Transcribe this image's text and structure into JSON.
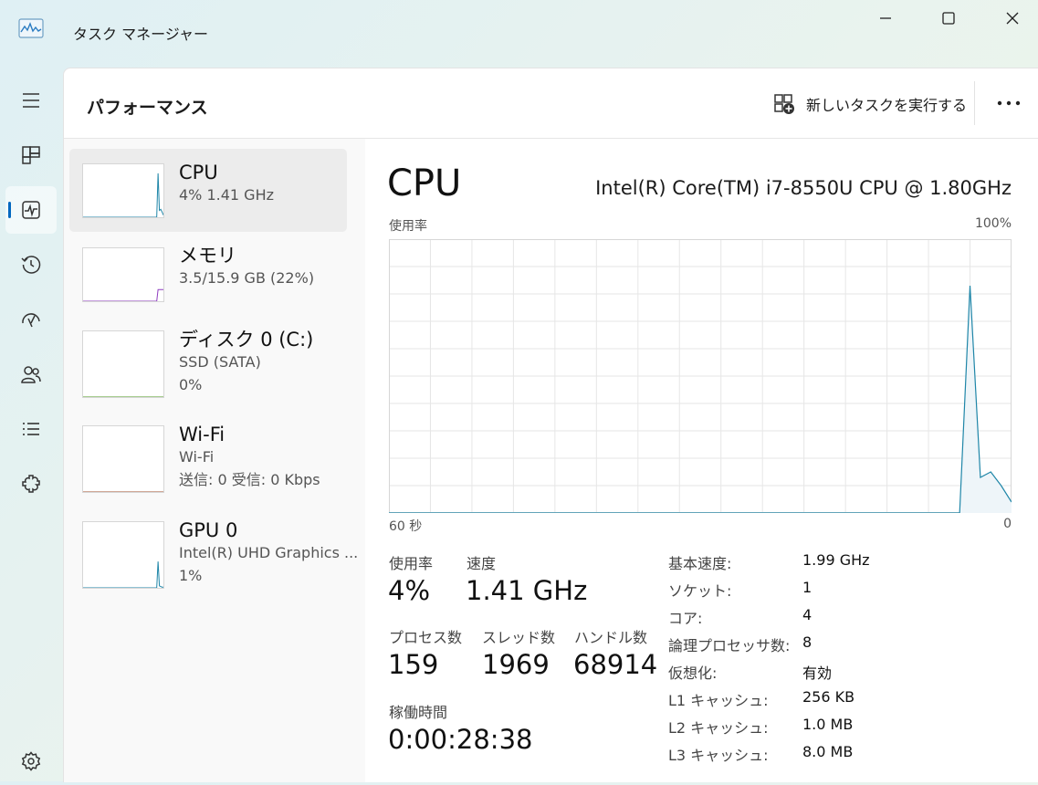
{
  "window": {
    "title": "タスク マネージャー",
    "controls": [
      "minimize-icon",
      "maximize-icon",
      "close-icon"
    ]
  },
  "nav": {
    "items": [
      {
        "name": "hamburger-icon",
        "active": false
      },
      {
        "name": "processes-icon",
        "active": false
      },
      {
        "name": "performance-icon",
        "active": true
      },
      {
        "name": "app-history-icon",
        "active": false
      },
      {
        "name": "startup-apps-icon",
        "active": false
      },
      {
        "name": "users-icon",
        "active": false
      },
      {
        "name": "details-icon",
        "active": false
      },
      {
        "name": "services-icon",
        "active": false
      },
      {
        "name": "settings-icon",
        "active": false
      }
    ]
  },
  "header": {
    "title": "パフォーマンス",
    "new_task_label": "新しいタスクを実行する",
    "new_task_icon": "new-task-icon",
    "more_icon": "more-options-icon"
  },
  "resources": [
    {
      "name": "CPU",
      "lines": [
        "4%  1.41 GHz"
      ],
      "active": true,
      "color": "#1f86a8",
      "thumb_series": [
        0,
        0,
        0,
        0,
        0,
        0,
        0,
        0,
        0,
        0,
        0,
        0,
        0,
        0,
        0,
        0,
        0,
        0,
        0,
        0,
        0,
        0,
        0,
        0,
        0,
        0,
        0,
        0,
        0,
        0,
        0,
        0,
        0,
        0,
        0,
        0,
        0,
        0,
        0,
        0,
        0,
        0,
        0,
        0,
        0,
        0,
        0,
        0,
        0,
        0,
        0,
        0,
        0,
        0,
        0,
        0,
        83,
        13,
        15,
        10,
        4
      ]
    },
    {
      "name": "メモリ",
      "lines": [
        "3.5/15.9 GB (22%)"
      ],
      "active": false,
      "color": "#8e3bbf",
      "thumb_series": [
        0,
        0,
        0,
        0,
        0,
        0,
        0,
        0,
        0,
        0,
        0,
        0,
        0,
        0,
        0,
        0,
        0,
        0,
        0,
        0,
        0,
        0,
        0,
        0,
        0,
        0,
        0,
        0,
        0,
        0,
        0,
        0,
        0,
        0,
        0,
        0,
        0,
        0,
        0,
        0,
        0,
        0,
        0,
        0,
        0,
        0,
        0,
        0,
        0,
        0,
        0,
        0,
        0,
        0,
        0,
        0,
        22,
        22,
        22,
        22,
        22
      ]
    },
    {
      "name": "ディスク 0 (C:)",
      "lines": [
        "SSD (SATA)",
        "0%"
      ],
      "active": false,
      "color": "#4d9a1c",
      "thumb_series": [
        0,
        0,
        0,
        0,
        0,
        0,
        0,
        0,
        0,
        0,
        0,
        0,
        0,
        0,
        0,
        0,
        0,
        0,
        0,
        0,
        0,
        0,
        0,
        0,
        0,
        0,
        0,
        0,
        0,
        0,
        0,
        0,
        0,
        0,
        0,
        0,
        0,
        0,
        0,
        0,
        0,
        0,
        0,
        0,
        0,
        0,
        0,
        0,
        0,
        0,
        0,
        0,
        0,
        0,
        0,
        0,
        0,
        0,
        0,
        0,
        0
      ]
    },
    {
      "name": "Wi-Fi",
      "lines": [
        "Wi-Fi",
        "送信: 0  受信: 0 Kbps"
      ],
      "active": false,
      "color": "#a0522d",
      "thumb_series": [
        0,
        0,
        0,
        0,
        0,
        0,
        0,
        0,
        0,
        0,
        0,
        0,
        0,
        0,
        0,
        0,
        0,
        0,
        0,
        0,
        0,
        0,
        0,
        0,
        0,
        0,
        0,
        0,
        0,
        0,
        0,
        0,
        0,
        0,
        0,
        0,
        0,
        0,
        0,
        0,
        0,
        0,
        0,
        0,
        0,
        0,
        0,
        0,
        0,
        0,
        0,
        0,
        0,
        0,
        0,
        0,
        0,
        0,
        0,
        0,
        0
      ]
    },
    {
      "name": "GPU 0",
      "lines": [
        "Intel(R) UHD Graphics ...",
        "1%"
      ],
      "active": false,
      "color": "#1f86a8",
      "thumb_series": [
        0,
        0,
        0,
        0,
        0,
        0,
        0,
        0,
        0,
        0,
        0,
        0,
        0,
        0,
        0,
        0,
        0,
        0,
        0,
        0,
        0,
        0,
        0,
        0,
        0,
        0,
        0,
        0,
        0,
        0,
        0,
        0,
        0,
        0,
        0,
        0,
        0,
        0,
        0,
        0,
        0,
        0,
        0,
        0,
        0,
        0,
        0,
        0,
        0,
        0,
        0,
        0,
        0,
        0,
        0,
        0,
        40,
        3,
        2,
        1,
        1
      ]
    }
  ],
  "detail": {
    "title": "CPU",
    "model": "Intel(R) Core(TM) i7-8550U CPU @ 1.80GHz",
    "graph": {
      "y_label": "使用率",
      "y_max_label": "100%",
      "x_left_label": "60 秒",
      "x_right_label": "0",
      "line_color": "#1f86a8",
      "fill_color": "#eef5f9",
      "grid_color": "#e6e6e6",
      "usage_percent_series": [
        0,
        0,
        0,
        0,
        0,
        0,
        0,
        0,
        0,
        0,
        0,
        0,
        0,
        0,
        0,
        0,
        0,
        0,
        0,
        0,
        0,
        0,
        0,
        0,
        0,
        0,
        0,
        0,
        0,
        0,
        0,
        0,
        0,
        0,
        0,
        0,
        0,
        0,
        0,
        0,
        0,
        0,
        0,
        0,
        0,
        0,
        0,
        0,
        0,
        0,
        0,
        0,
        0,
        0,
        0,
        0,
        83,
        13,
        15,
        10,
        4
      ]
    },
    "stats": {
      "usage_label": "使用率",
      "usage_value": "4%",
      "speed_label": "速度",
      "speed_value": "1.41 GHz",
      "processes_label": "プロセス数",
      "processes_value": "159",
      "threads_label": "スレッド数",
      "threads_value": "1969",
      "handles_label": "ハンドル数",
      "handles_value": "68914",
      "uptime_label": "稼働時間",
      "uptime_value": "0:00:28:38"
    },
    "specs": [
      {
        "key": "基本速度:",
        "value": "1.99 GHz"
      },
      {
        "key": "ソケット:",
        "value": "1"
      },
      {
        "key": "コア:",
        "value": "4"
      },
      {
        "key": "論理プロセッサ数:",
        "value": "8"
      },
      {
        "key": "仮想化:",
        "value": "有効"
      },
      {
        "key": "L1 キャッシュ:",
        "value": "256 KB"
      },
      {
        "key": "L2 キャッシュ:",
        "value": "1.0 MB"
      },
      {
        "key": "L3 キャッシュ:",
        "value": "8.0 MB"
      }
    ]
  }
}
